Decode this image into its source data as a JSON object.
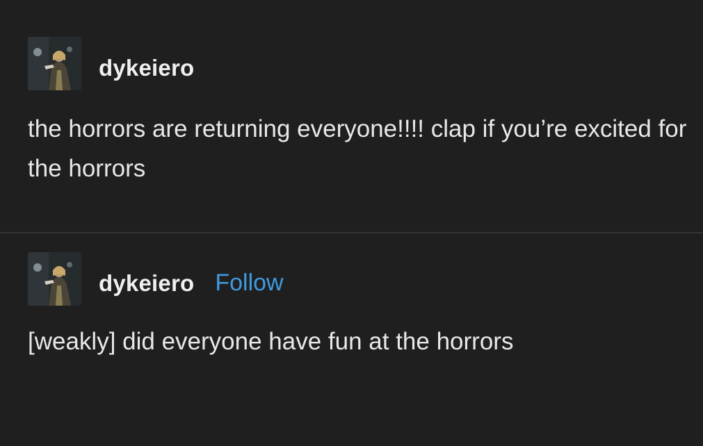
{
  "posts": [
    {
      "avatar_icon": "user-avatar-photo",
      "username": "dykeiero",
      "body": "the horrors are returning everyone!!!! clap if you’re excited for the horrors"
    },
    {
      "avatar_icon": "user-avatar-photo",
      "username": "dykeiero",
      "follow_label": "Follow",
      "body": "[weakly] did everyone have fun at the horrors"
    }
  ],
  "colors": {
    "background": "#1f1f1f",
    "text": "#e8e8e8",
    "follow": "#3f9ae0",
    "divider": "#353535"
  }
}
